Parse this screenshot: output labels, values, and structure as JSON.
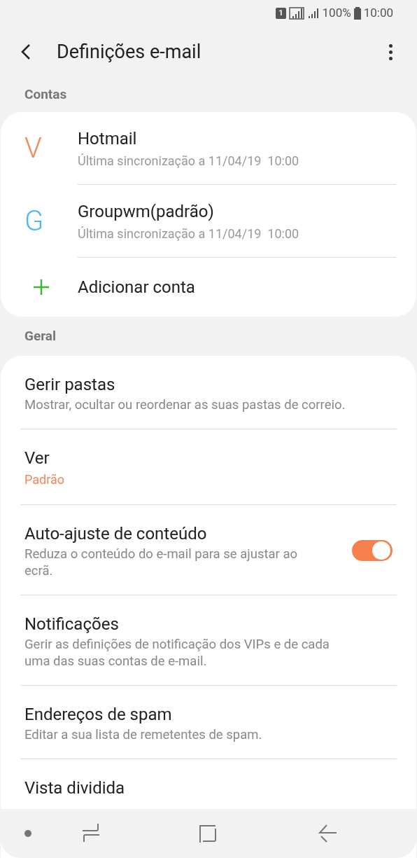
{
  "status_bar": {
    "sim": "1",
    "battery": "100%",
    "time": "10:00"
  },
  "header": {
    "title": "Definições e-mail"
  },
  "accounts_section": {
    "title": "Contas",
    "accounts": [
      {
        "letter": "V",
        "color": "#f0885a",
        "name": "Hotmail",
        "subtitle": "Última sincronização a 11/04/19  10:00"
      },
      {
        "letter": "G",
        "color": "#4fb8ec",
        "name": "Groupwm(padrão)",
        "subtitle": "Última sincronização a 11/04/19  10:00"
      }
    ],
    "add_label": "Adicionar conta"
  },
  "general_section": {
    "title": "Geral",
    "items": [
      {
        "kind": "text",
        "title": "Gerir pastas",
        "subtitle": "Mostrar, ocultar ou reordenar as suas pastas de correio."
      },
      {
        "kind": "value",
        "title": "Ver",
        "value": "Padrão"
      },
      {
        "kind": "switch",
        "title": "Auto-ajuste de conteúdo",
        "subtitle": "Reduza o conteúdo do e-mail para se ajustar ao ecrã.",
        "on": true
      },
      {
        "kind": "text",
        "title": "Notificações",
        "subtitle": "Gerir as definições de notificação dos VIPs e de cada uma das suas contas de e-mail."
      },
      {
        "kind": "text",
        "title": "Endereços de spam",
        "subtitle": "Editar a sua lista de remetentes de spam."
      },
      {
        "kind": "text",
        "title": "Vista dividida"
      }
    ]
  }
}
